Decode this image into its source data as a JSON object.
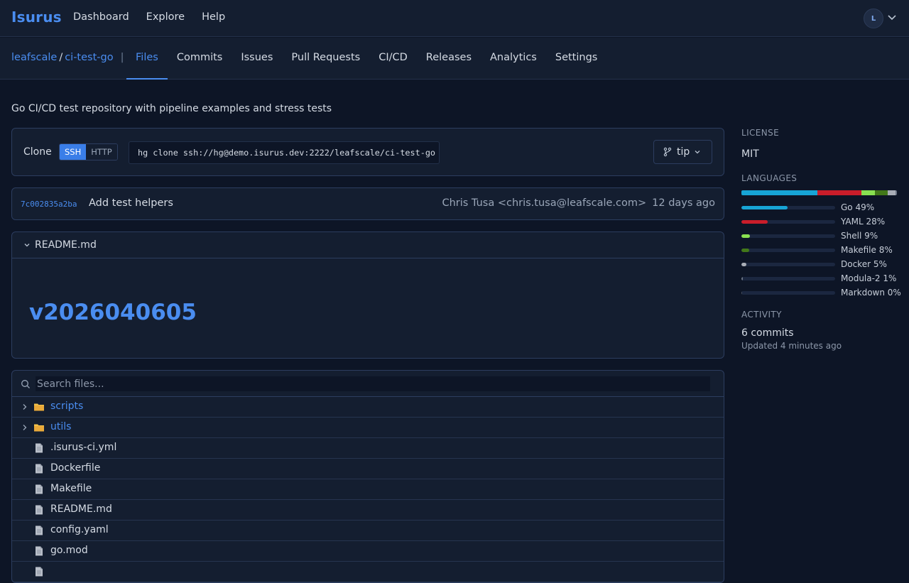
{
  "app": {
    "brand": "Isurus"
  },
  "topnav": [
    "Dashboard",
    "Explore",
    "Help"
  ],
  "user": {
    "avatar_initial": "L"
  },
  "repo": {
    "owner": "leafscale",
    "name": "ci-test-go",
    "description": "Go CI/CD test repository with pipeline examples and stress tests"
  },
  "tabs": [
    {
      "label": "Files",
      "active": true
    },
    {
      "label": "Commits",
      "active": false
    },
    {
      "label": "Issues",
      "active": false
    },
    {
      "label": "Pull Requests",
      "active": false
    },
    {
      "label": "CI/CD",
      "active": false
    },
    {
      "label": "Releases",
      "active": false
    },
    {
      "label": "Analytics",
      "active": false
    },
    {
      "label": "Settings",
      "active": false
    }
  ],
  "clone": {
    "label": "Clone",
    "protocols": [
      "SSH",
      "HTTP"
    ],
    "selected_protocol": "SSH",
    "url": "hg clone ssh://hg@demo.isurus.dev:2222/leafscale/ci-test-go",
    "branch": "tip"
  },
  "last_commit": {
    "hash": "7c002835a2ba",
    "message": "Add test helpers",
    "author": "Chris Tusa <chris.tusa@leafscale.com>",
    "ago": "12 days ago"
  },
  "readme": {
    "filename": "README.md",
    "heading": "v2026040605"
  },
  "file_browser": {
    "search_placeholder": "Search files...",
    "entries": [
      {
        "name": "scripts",
        "type": "dir"
      },
      {
        "name": "utils",
        "type": "dir"
      },
      {
        "name": ".isurus-ci.yml",
        "type": "file"
      },
      {
        "name": "Dockerfile",
        "type": "file"
      },
      {
        "name": "Makefile",
        "type": "file"
      },
      {
        "name": "README.md",
        "type": "file"
      },
      {
        "name": "config.yaml",
        "type": "file"
      },
      {
        "name": "go.mod",
        "type": "file"
      },
      {
        "name": "",
        "type": "file"
      }
    ]
  },
  "sidebar": {
    "license_heading": "LICENSE",
    "license": "MIT",
    "languages_heading": "LANGUAGES",
    "languages": [
      {
        "name": "Go",
        "percent": 49,
        "label": "Go 49%",
        "color": "#17a5d6"
      },
      {
        "name": "YAML",
        "percent": 28,
        "label": "YAML 28%",
        "color": "#c91d2a"
      },
      {
        "name": "Shell",
        "percent": 9,
        "label": "Shell 9%",
        "color": "#89e051"
      },
      {
        "name": "Makefile",
        "percent": 8,
        "label": "Makefile 8%",
        "color": "#427819"
      },
      {
        "name": "Docker",
        "percent": 5,
        "label": "Docker 5%",
        "color": "#a8adb6"
      },
      {
        "name": "Modula-2",
        "percent": 1,
        "label": "Modula-2 1%",
        "color": "#6c7585"
      },
      {
        "name": "Markdown",
        "percent": 0,
        "label": "Markdown 0%",
        "color": "#4a5160"
      }
    ],
    "activity_heading": "ACTIVITY",
    "commits": "6 commits",
    "updated": "Updated 4 minutes ago"
  },
  "colors": {
    "accent": "#4a8df0",
    "background": "#0d1526",
    "panel": "#141e30",
    "border": "#2c3d5f",
    "folder": "#f2c14a"
  }
}
